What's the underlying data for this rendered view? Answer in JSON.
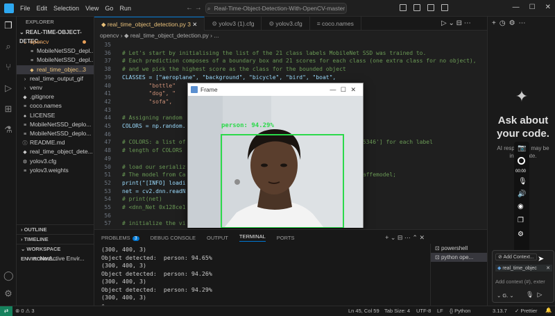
{
  "menu": [
    "File",
    "Edit",
    "Selection",
    "View",
    "Go",
    "Run"
  ],
  "titlebar": {
    "nav_arrows": "← →",
    "search": "Real-Time-Object-Detection-With-OpenCV-master"
  },
  "sidebar": {
    "title": "EXPLORER",
    "root": "REAL-TIME-OBJECT-DETEC...",
    "items": [
      {
        "label": "opencv",
        "ic": "⌄",
        "indent": 8,
        "color": "#e8a05a",
        "dot": true
      },
      {
        "label": "MobileNetSSD_depl...",
        "ic": "≡",
        "indent": 18
      },
      {
        "label": "MobileNetSSD_depl...",
        "ic": "≡",
        "indent": 18
      },
      {
        "label": "real_time_objec...",
        "ic": "◆",
        "indent": 18,
        "color": "#e8c07a",
        "badge": "3"
      },
      {
        "label": "real_time_output_gif",
        "ic": "›",
        "indent": 8
      },
      {
        "label": "venv",
        "ic": "›",
        "indent": 8
      },
      {
        "label": ".gitignore",
        "ic": "◆",
        "indent": 8
      },
      {
        "label": "coco.names",
        "ic": "≡",
        "indent": 8
      },
      {
        "label": "LICENSE",
        "ic": "♠",
        "indent": 8
      },
      {
        "label": "MobileNetSSD_deplo...",
        "ic": "≡",
        "indent": 8
      },
      {
        "label": "MobileNetSSD_deplo...",
        "ic": "≡",
        "indent": 8
      },
      {
        "label": "README.md",
        "ic": "ⓘ",
        "indent": 8
      },
      {
        "label": "real_time_object_dete...",
        "ic": "◆",
        "indent": 8
      },
      {
        "label": "yolov3.cfg",
        "ic": "⚙",
        "indent": 8
      },
      {
        "label": "yolov3.weights",
        "ic": "≡",
        "indent": 8
      }
    ],
    "outline": "OUTLINE",
    "timeline": "TIMELINE",
    "workspace": "WORKSPACE ENVIRONME...",
    "no_env": "No Active Envir..."
  },
  "tabs": [
    {
      "label": "real_time_object_detection.py 3",
      "active": true,
      "icon": "◆",
      "icon_color": "#e8c07a"
    },
    {
      "label": "yolov3 (1).cfg",
      "active": false,
      "icon": "⚙",
      "icon_color": "#888"
    },
    {
      "label": "yolov3.cfg",
      "active": false,
      "icon": "⚙",
      "icon_color": "#888"
    },
    {
      "label": "coco.names",
      "active": false,
      "icon": "≡",
      "icon_color": "#888"
    }
  ],
  "tab_actions": "▷ ⌄ ⊟ ⋯",
  "breadcrumb": "opencv  ›  ◆ real_time_object_detection.py  ›  ...",
  "code": [
    {
      "n": "35",
      "t": ""
    },
    {
      "n": "36",
      "t": "# Let's start by initialising the list of the 21 class labels MobileNet SSD was trained to.",
      "c": "cm"
    },
    {
      "n": "37",
      "t": "# Each prediction composes of a boundary box and 21 scores for each class (one extra class for no object),",
      "c": "cm"
    },
    {
      "n": "38",
      "t": "# and we pick the highest score as the class for the bounded object",
      "c": "cm"
    },
    {
      "n": "39",
      "t": "CLASSES = [\"aeroplane\", \"background\", \"bicycle\", \"bird\", \"boat\",",
      "c": "mix"
    },
    {
      "n": "40",
      "t": "        \"bottle\"",
      "c": "str"
    },
    {
      "n": "41",
      "t": "        \"dog\", \"                                                   \",",
      "c": "str"
    },
    {
      "n": "42",
      "t": "        \"sofa\",",
      "c": "str"
    },
    {
      "n": "43",
      "t": ""
    },
    {
      "n": "44",
      "t": "# Assigning random",
      "c": "cm"
    },
    {
      "n": "45",
      "t": "COLORS = np.random.",
      "c": "mix"
    },
    {
      "n": "46",
      "t": ""
    },
    {
      "n": "47",
      "t": "# COLORS: a list of                                              11.84805346'] for each label",
      "c": "cm"
    },
    {
      "n": "48",
      "t": "# length of COLORS",
      "c": "cm"
    },
    {
      "n": "49",
      "t": ""
    },
    {
      "n": "50",
      "t": "# load our serializ",
      "c": "cm"
    },
    {
      "n": "51",
      "t": "# The model from Ca                                             deploy.caffemodel;",
      "c": "cm"
    },
    {
      "n": "52",
      "t": "print(\"[INFO] loadi",
      "c": "mix"
    },
    {
      "n": "53",
      "t": "net = cv2.dnn.readN",
      "c": "mix"
    },
    {
      "n": "54",
      "t": "# print(net)",
      "c": "cm"
    },
    {
      "n": "55",
      "t": "# <dnn_Net 0x128ce1",
      "c": "cm"
    },
    {
      "n": "56",
      "t": ""
    },
    {
      "n": "57",
      "t": "# initialize the vi",
      "c": "cm"
    }
  ],
  "frame_window": {
    "title": "Frame",
    "detection_label": "person: 94.29%",
    "box_color": "#2bd94a",
    "controls": "—  ☐  ✕"
  },
  "panel": {
    "tabs": [
      {
        "label": "PROBLEMS",
        "badge": "3"
      },
      {
        "label": "DEBUG CONSOLE"
      },
      {
        "label": "OUTPUT"
      },
      {
        "label": "TERMINAL",
        "active": true
      },
      {
        "label": "PORTS"
      }
    ],
    "actions": "+ ⌄ ⊟ ⋯  ⌃ ✕",
    "terminal_lines": [
      "(300, 400, 3)",
      "Object detected:  person: 94.65%",
      "(300, 400, 3)",
      "Object detected:  person: 94.26%",
      "(300, 400, 3)",
      "Object detected:  person: 94.29%",
      "(300, 400, 3)",
      "▯"
    ],
    "terminals": [
      "powershell",
      "python ope..."
    ]
  },
  "chat": {
    "heading": "Ask about your code.",
    "subtext": "AI responses may be inaccurate.",
    "recorder_time": "00:00",
    "add_context": "Add Context...",
    "context_file": "real_time_objec",
    "input_placeholder": "Add context (#), exter",
    "model": "G."
  },
  "status": {
    "left": "⊗ 0  ⚠ 3",
    "position": "Ln 45, Col 59",
    "tab_size": "Tab Size: 4",
    "encoding": "UTF-8",
    "eol": "LF",
    "language": "{} Python",
    "version": "3.13.7",
    "prettier": "✓ Prettier",
    "bell": "🔔"
  }
}
